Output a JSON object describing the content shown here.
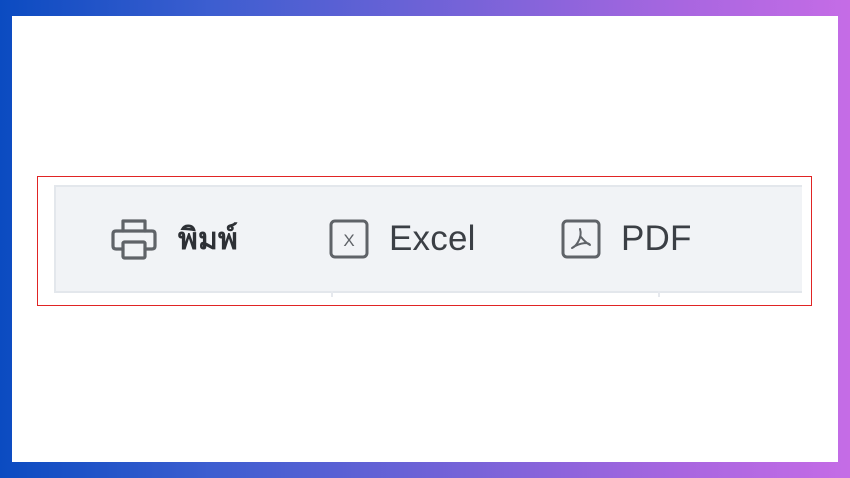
{
  "toolbar": {
    "buttons": [
      {
        "id": "print",
        "label": "พิมพ์",
        "icon": "printer-icon"
      },
      {
        "id": "excel",
        "label": "Excel",
        "icon": "excel-file-icon",
        "icon_glyph": "X"
      },
      {
        "id": "pdf",
        "label": "PDF",
        "icon": "pdf-file-icon"
      }
    ]
  },
  "colors": {
    "toolbar_background": "#f1f3f6",
    "icon_stroke": "#5f6368",
    "label_text": "#3b3f45",
    "highlight_border": "#e02424"
  }
}
